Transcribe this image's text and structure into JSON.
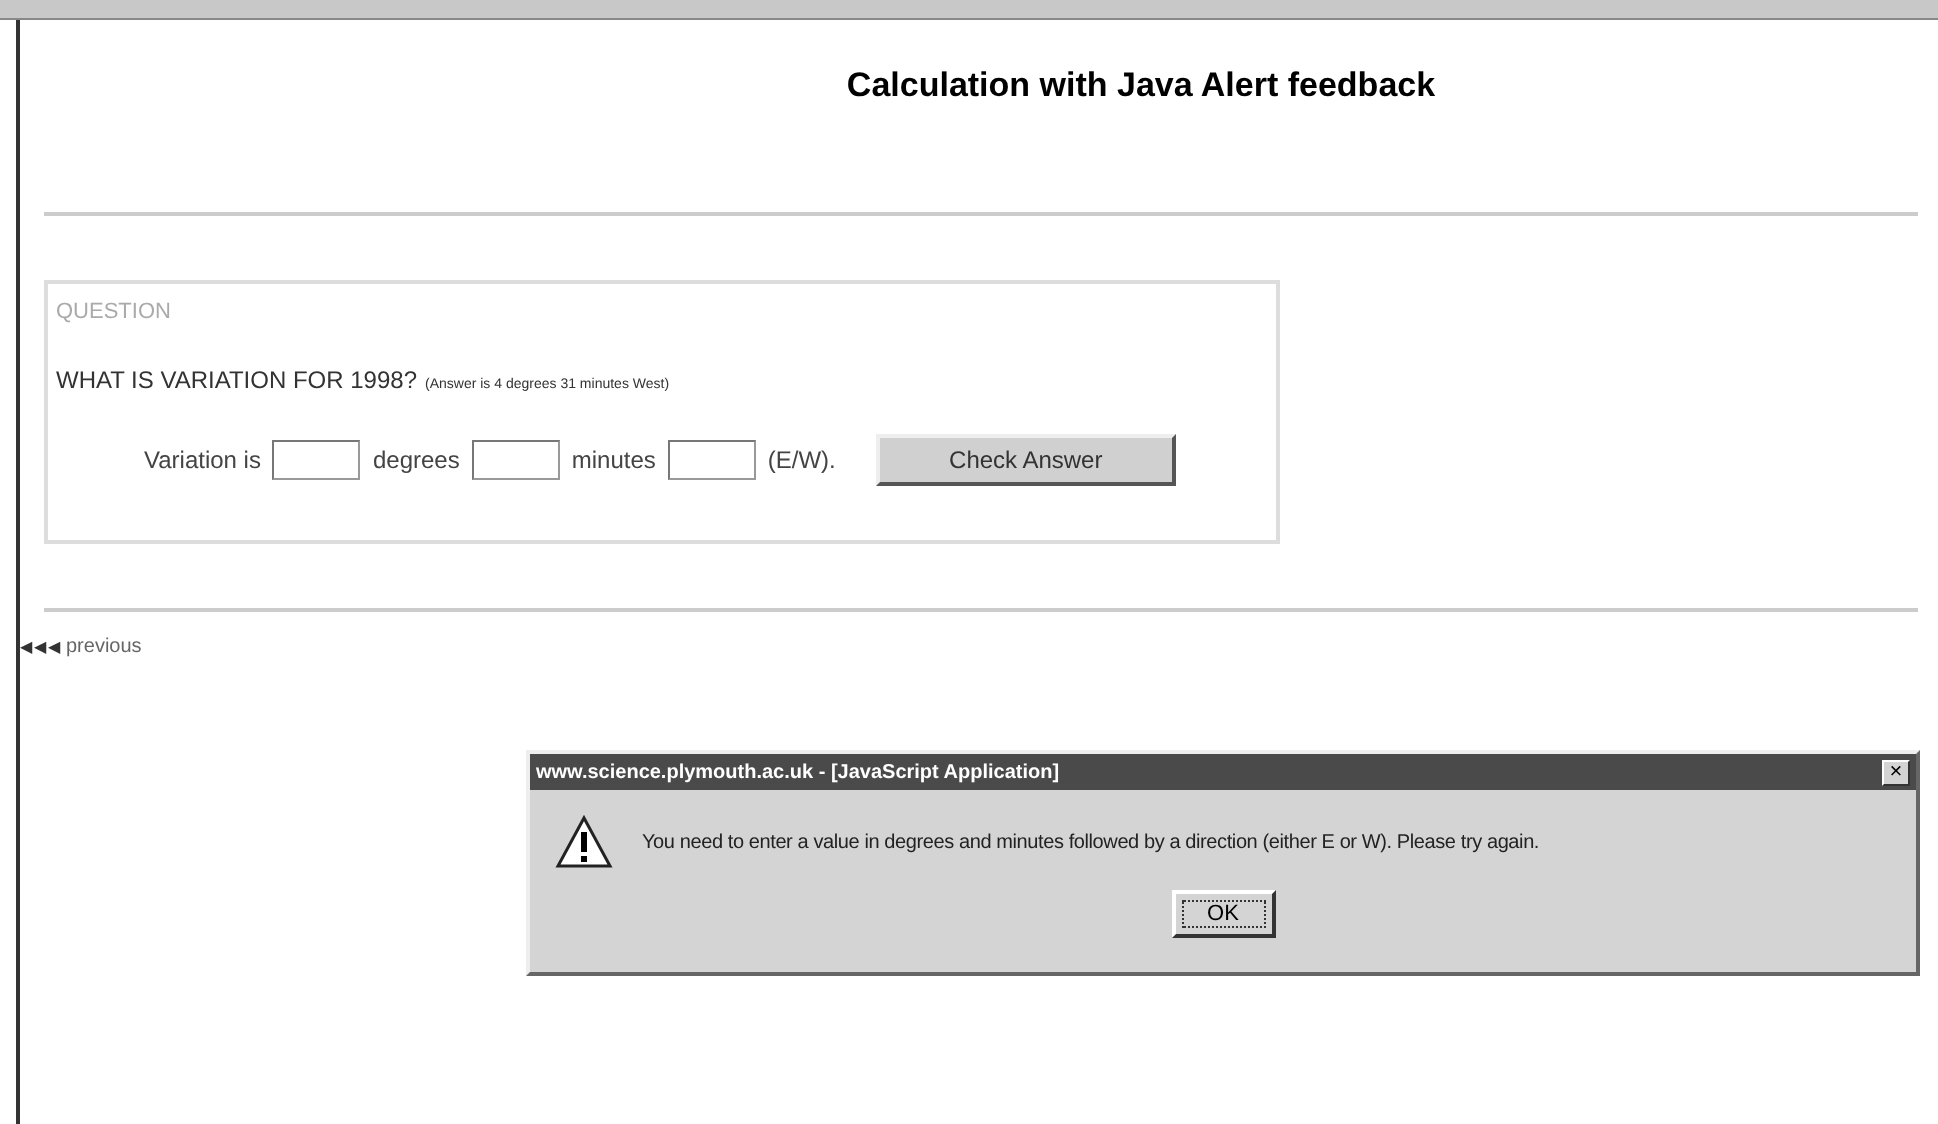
{
  "page": {
    "title": "Calculation with Java Alert feedback"
  },
  "question": {
    "legend": "QUESTION",
    "text": "WHAT IS VARIATION FOR 1998?",
    "hint": "(Answer is 4 degrees 31 minutes West)",
    "parts": [
      {
        "kind": "label",
        "text": "Variation is"
      },
      {
        "kind": "input"
      },
      {
        "kind": "label",
        "text": "degrees"
      },
      {
        "kind": "input"
      },
      {
        "kind": "label",
        "text": "minutes"
      },
      {
        "kind": "input"
      },
      {
        "kind": "label",
        "text": "(E/W)."
      }
    ],
    "button": "Check Answer"
  },
  "nav": {
    "arrows": "◀◀◀",
    "link": "previous"
  },
  "dialog": {
    "title": "www.science.plymouth.ac.uk - [JavaScript Application]",
    "close": "×",
    "message": "You need to enter a value in degrees and minutes followed by a direction (either  E or W).  Please try again.",
    "button": "OK"
  }
}
